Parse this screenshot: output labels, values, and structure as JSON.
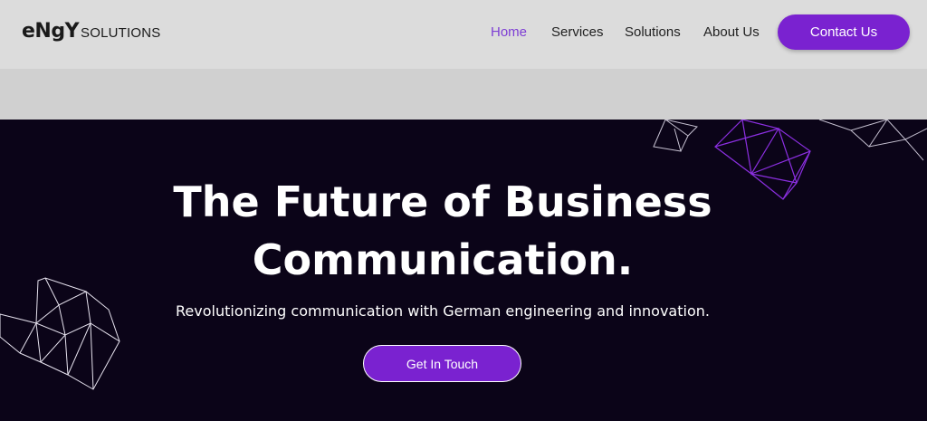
{
  "logo": {
    "mark": "eNgY",
    "text": "SOLUTIONS"
  },
  "nav": {
    "items": [
      {
        "label": "Home",
        "active": true
      },
      {
        "label": "Services"
      },
      {
        "label": "Solutions"
      },
      {
        "label": "About Us"
      }
    ]
  },
  "header": {
    "contact_label": "Contact Us"
  },
  "hero": {
    "title_line1": "The Future of Business",
    "title_line2": "Communication.",
    "subtitle": "Revolutionizing communication with German engineering and innovation.",
    "cta_label": "Get In Touch"
  },
  "colors": {
    "accent": "#7a22d0",
    "active_nav": "#7e3fd4",
    "hero_bg": "#0b0418",
    "header_bg": "#dcdcdc"
  }
}
